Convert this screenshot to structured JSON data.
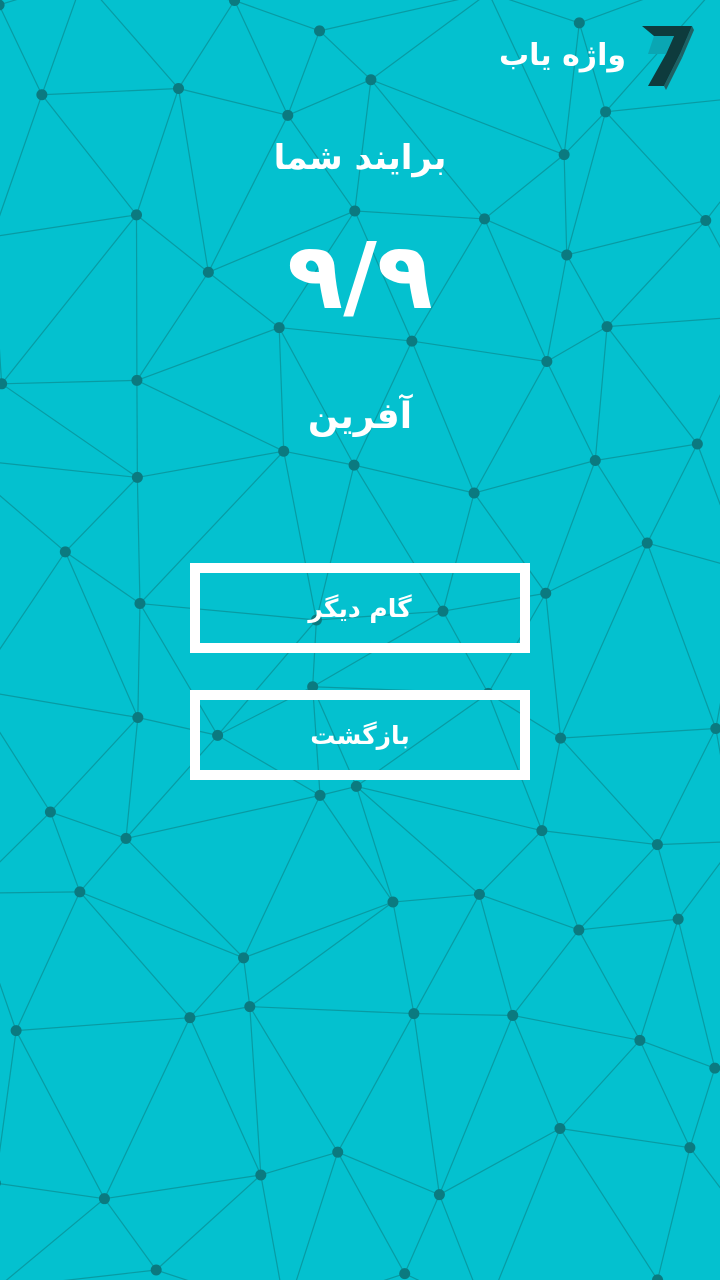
{
  "app": {
    "name": "واژه یاب",
    "logo_icon": "brand-logo-icon"
  },
  "theme": {
    "background": "#04c1cf",
    "pattern_line": "#0a8d94",
    "pattern_node": "#0b7a80",
    "text": "#ffffff",
    "logo_dark": "#0e3b3d"
  },
  "result": {
    "heading": "برایند شما",
    "score": "۹/۹",
    "message": "آفرین"
  },
  "buttons": {
    "next_label": "گام دیگر",
    "back_label": "بازگشت"
  }
}
